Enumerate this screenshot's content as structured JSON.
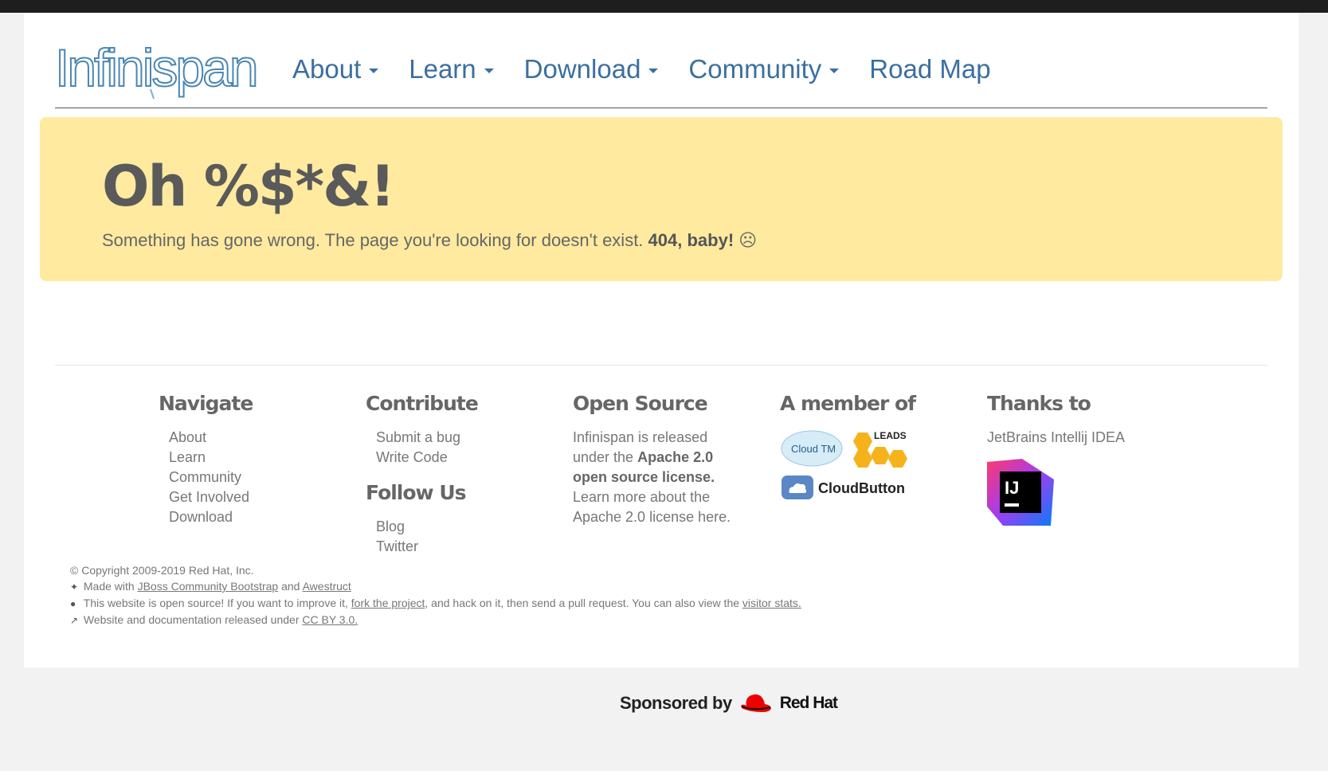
{
  "header": {
    "logo_text": "Infinispan",
    "nav": [
      {
        "label": "About",
        "has_dropdown": true
      },
      {
        "label": "Learn",
        "has_dropdown": true
      },
      {
        "label": "Download",
        "has_dropdown": true
      },
      {
        "label": "Community",
        "has_dropdown": true
      },
      {
        "label": "Road Map",
        "has_dropdown": false
      }
    ]
  },
  "alert": {
    "title": "Oh %$*&!",
    "message": "Something has gone wrong. The page you're looking for doesn't exist.",
    "emphasis": "404, baby!",
    "emoji": "☹"
  },
  "footer": {
    "navigate": {
      "heading": "Navigate",
      "links": [
        "About",
        "Learn",
        "Community",
        "Get Involved",
        "Download"
      ]
    },
    "contribute": {
      "heading": "Contribute",
      "links": [
        "Submit a bug",
        "Write Code"
      ]
    },
    "follow": {
      "heading": "Follow Us",
      "links": [
        "Blog",
        "Twitter"
      ]
    },
    "open_source": {
      "heading": "Open Source",
      "text_pre": "Infinispan is released under the",
      "text_bold": "Apache 2.0 open source license.",
      "text_post": "Learn more about the Apache 2.0 license here."
    },
    "member": {
      "heading": "A member of",
      "badges": [
        "Cloud TM",
        "LEADS",
        "CloudButton"
      ]
    },
    "thanks": {
      "heading": "Thanks to",
      "text": "JetBrains Intellij IDEA",
      "logo_text": "IJ"
    },
    "copyright": "© Copyright 2009-2019 Red Hat, Inc.",
    "made_with_pre": "Made with",
    "made_with_link1": "JBoss Community Bootstrap",
    "made_with_and": "and",
    "made_with_link2": "Awestruct",
    "opensource_pre": "This website is open source! If you want to improve it,",
    "opensource_link1": "fork the project",
    "opensource_mid": ", and hack on it, then send a pull request. You can also view the",
    "opensource_link2": "visitor stats.",
    "license_pre": "Website and documentation released under",
    "license_link": "CC BY 3.0."
  },
  "sponsor": {
    "label": "Sponsored by",
    "brand": "Red Hat"
  },
  "colors": {
    "link": "#3b6fa0",
    "alert_bg": "#ffeaa0",
    "topbar": "#1e1e1e",
    "redhat": "#ee0000"
  }
}
